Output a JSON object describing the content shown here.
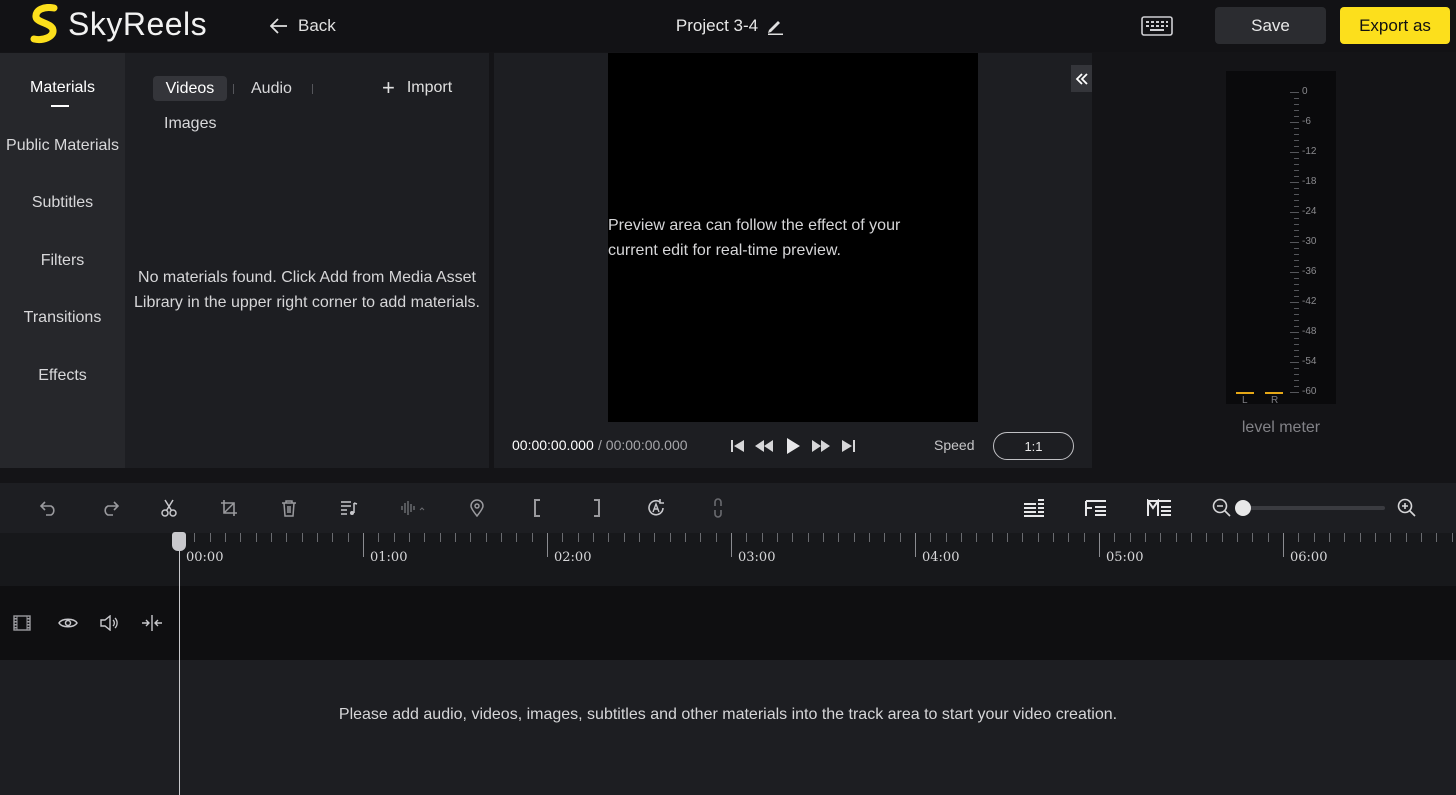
{
  "header": {
    "logo_text": "SkyReels",
    "back_label": "Back",
    "project_title": "Project 3-4",
    "save_label": "Save",
    "export_label": "Export as",
    "accent_color": "#fcdf1c"
  },
  "left_nav": {
    "items": [
      {
        "label": "Materials",
        "active": true
      },
      {
        "label": "Public Materials"
      },
      {
        "label": "Subtitles"
      },
      {
        "label": "Filters"
      },
      {
        "label": "Transitions"
      },
      {
        "label": "Effects"
      }
    ]
  },
  "materials": {
    "tabs": [
      "Videos",
      "Audio",
      "Images"
    ],
    "active_tab": "Videos",
    "import_label": "Import",
    "empty_message": "No materials found. Click Add from Media Asset Library in the upper right corner to add materials."
  },
  "preview": {
    "message": "Preview area can follow the effect of your current edit for real-time preview.",
    "current_time": "00:00:00.000",
    "total_time": "/ 00:00:00.000",
    "speed_label": "Speed",
    "ratio": "1:1"
  },
  "level_meter": {
    "title": "level meter",
    "scale": [
      "0",
      "-6",
      "-12",
      "-18",
      "-24",
      "-30",
      "-36",
      "-42",
      "-48",
      "-54",
      "-60"
    ],
    "channels": [
      "L",
      "R"
    ],
    "level_color": "#e6a817"
  },
  "timeline": {
    "ruler_labels": [
      "00:00",
      "01:00",
      "02:00",
      "03:00",
      "04:00",
      "05:00",
      "06:00"
    ],
    "empty_message": "Please add audio, videos, images, subtitles and other materials into the track area to start your video creation."
  },
  "icons": {
    "toolbar": [
      "undo-icon",
      "redo-icon",
      "scissors-icon",
      "crop-icon",
      "trash-icon",
      "music-list-icon",
      "audio-wave-icon",
      "location-pin-icon",
      "bracket-left-icon",
      "bracket-right-icon",
      "rotate-a-icon",
      "link-icon",
      "track-layout-1-icon",
      "track-layout-2-icon",
      "track-layout-3-icon",
      "zoom-out-icon",
      "zoom-in-icon"
    ],
    "track": [
      "film-icon",
      "eye-icon",
      "volume-icon",
      "split-track-icon"
    ]
  }
}
